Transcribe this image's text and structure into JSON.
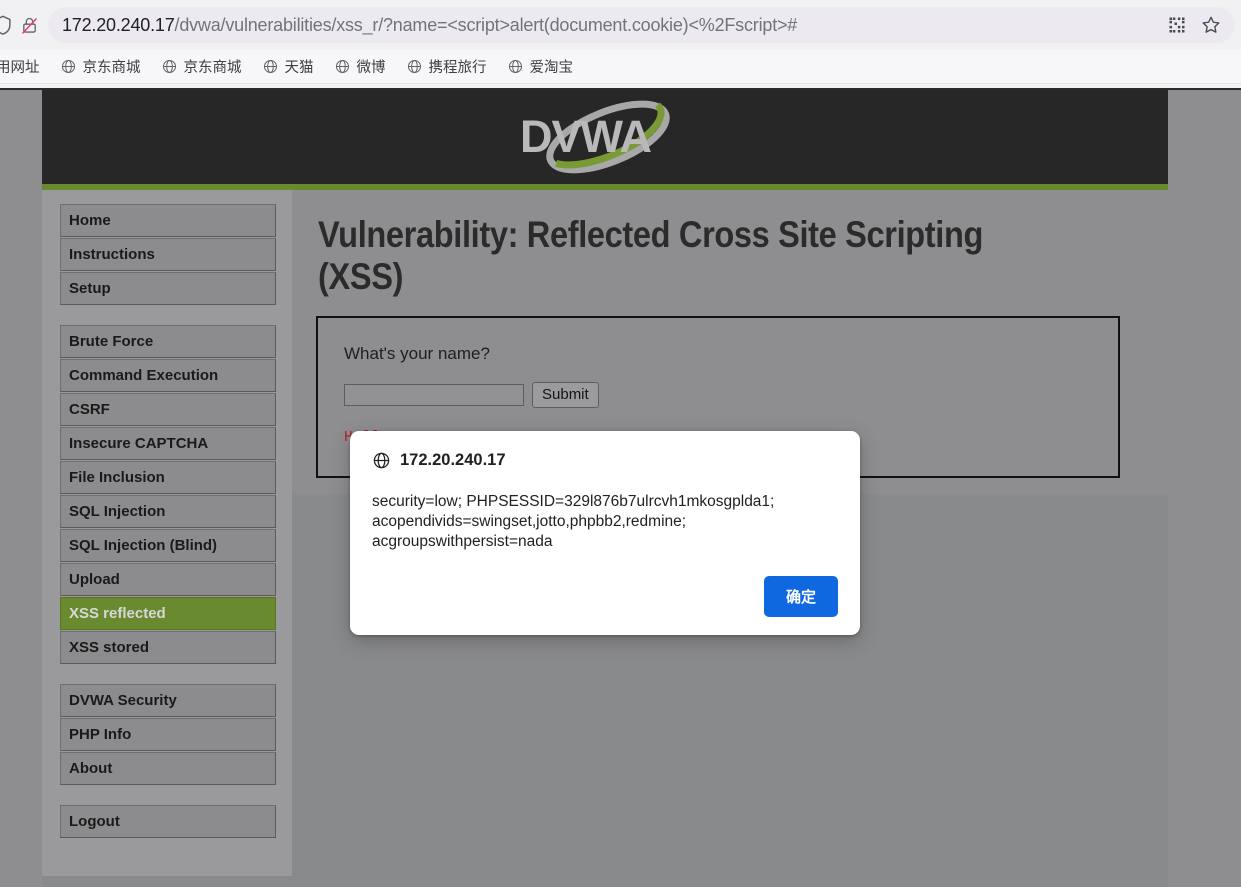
{
  "browser": {
    "url_host": "172.20.240.17",
    "url_path": "/dvwa/vulnerabilities/xss_r/?name=<script>alert(document.cookie)<%2Fscript>#",
    "security_icon": "insecure-lock-icon",
    "qr_icon": "qr-code-icon",
    "bookmark_star_icon": "star-icon",
    "bookmarks": [
      {
        "label": "用网址",
        "icon": "globe-icon"
      },
      {
        "label": "京东商城",
        "icon": "globe-icon"
      },
      {
        "label": "京东商城",
        "icon": "globe-icon"
      },
      {
        "label": "天猫",
        "icon": "globe-icon"
      },
      {
        "label": "微博",
        "icon": "globe-icon"
      },
      {
        "label": "携程旅行",
        "icon": "globe-icon"
      },
      {
        "label": "爱淘宝",
        "icon": "globe-icon"
      }
    ]
  },
  "site": {
    "logo_text": "DVWA",
    "accent_green": "#6a8a2f",
    "header_bg": "#272727"
  },
  "sidebar": {
    "groups": [
      {
        "items": [
          {
            "label": "Home",
            "active": false
          },
          {
            "label": "Instructions",
            "active": false
          },
          {
            "label": "Setup",
            "active": false
          }
        ]
      },
      {
        "items": [
          {
            "label": "Brute Force",
            "active": false
          },
          {
            "label": "Command Execution",
            "active": false
          },
          {
            "label": "CSRF",
            "active": false
          },
          {
            "label": "Insecure CAPTCHA",
            "active": false
          },
          {
            "label": "File Inclusion",
            "active": false
          },
          {
            "label": "SQL Injection",
            "active": false
          },
          {
            "label": "SQL Injection (Blind)",
            "active": false
          },
          {
            "label": "Upload",
            "active": false
          },
          {
            "label": "XSS reflected",
            "active": true
          },
          {
            "label": "XSS stored",
            "active": false
          }
        ]
      },
      {
        "items": [
          {
            "label": "DVWA Security",
            "active": false
          },
          {
            "label": "PHP Info",
            "active": false
          },
          {
            "label": "About",
            "active": false
          }
        ]
      },
      {
        "items": [
          {
            "label": "Logout",
            "active": false
          }
        ]
      }
    ]
  },
  "main": {
    "title": "Vulnerability: Reflected Cross Site Scripting (XSS)",
    "form": {
      "question": "What's your name?",
      "input_value": "",
      "input_placeholder": "",
      "submit_label": "Submit"
    },
    "output": "Hello"
  },
  "dialog": {
    "origin": "172.20.240.17",
    "origin_icon": "globe-icon",
    "message": "security=low; PHPSESSID=329l876b7ulrcvh1mkosgplda1; acopendivids=swingset,jotto,phpbb2,redmine; acgroupswithpersist=nada",
    "ok_label": "确定",
    "ok_color": "#1068e0"
  }
}
